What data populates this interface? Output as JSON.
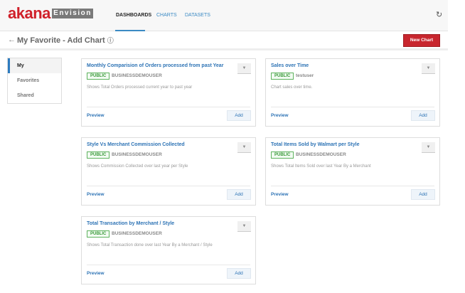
{
  "header": {
    "logo": "akana",
    "product": "Envision",
    "nav": [
      "DASHBOARDS",
      "CHARTS",
      "DATASETS"
    ],
    "refresh_icon": "refresh-icon"
  },
  "page": {
    "title": "My Favorite - Add Chart",
    "back_icon": "←",
    "help_icon": "?",
    "new_chart": "New Chart"
  },
  "sidebar": {
    "items": [
      "My",
      "Favorites",
      "Shared"
    ]
  },
  "cards": [
    {
      "title": "Monthly Comparision of Orders processed from past Year",
      "badge": "PUBLIC",
      "owner": "BUSINESSDEMOUSER",
      "description": "Shows Total Orders processed current year to past year",
      "preview": "Preview",
      "add": "Add"
    },
    {
      "title": "Sales over Time",
      "badge": "PUBLIC",
      "owner": "testuser",
      "description": "Chart sales over time.",
      "preview": "Preview",
      "add": "Add"
    },
    {
      "title": "Style Vs Merchant Commission Collected",
      "badge": "PUBLIC",
      "owner": "BUSINESSDEMOUSER",
      "description": "Shows Commission Collected over last year per Style",
      "preview": "Preview",
      "add": "Add"
    },
    {
      "title": "Total Items Sold by Walmart per Style",
      "badge": "PUBLIC",
      "owner": "BUSINESSDEMOUSER",
      "description": "Shows Total Items Sold over last Year By a Merchant",
      "preview": "Preview",
      "add": "Add"
    },
    {
      "title": "Total Transaction by Merchant / Style",
      "badge": "PUBLIC",
      "owner": "BUSINESSDEMOUSER",
      "description": "Shows Total Transaction done over last Year By a Merchant / Style",
      "preview": "Preview",
      "add": "Add"
    }
  ]
}
